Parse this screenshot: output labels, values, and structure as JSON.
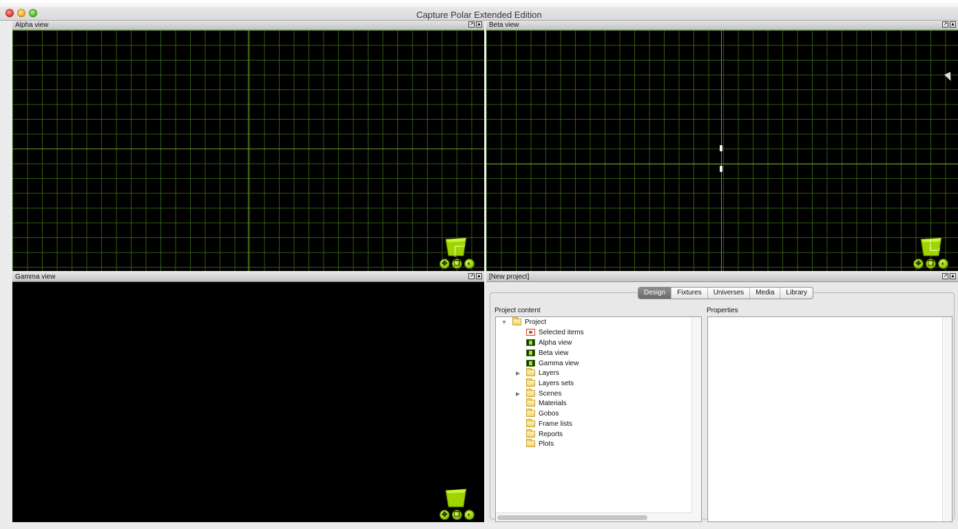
{
  "window": {
    "title": "Capture Polar Extended Edition"
  },
  "views": {
    "alpha": {
      "title": "Alpha view"
    },
    "beta": {
      "title": "Beta view"
    },
    "gamma": {
      "title": "Gamma view"
    }
  },
  "project_panel": {
    "title": "[New project]",
    "tabs": [
      {
        "label": "Design",
        "active": true
      },
      {
        "label": "Fixtures",
        "active": false
      },
      {
        "label": "Universes",
        "active": false
      },
      {
        "label": "Media",
        "active": false
      },
      {
        "label": "Library",
        "active": false
      }
    ],
    "content_label": "Project content",
    "properties_label": "Properties",
    "tree": [
      {
        "label": "Project",
        "icon": "folder-icon",
        "expanded": true
      },
      {
        "label": "Selected items",
        "icon": "selection-icon"
      },
      {
        "label": "Alpha view",
        "icon": "view-icon"
      },
      {
        "label": "Beta view",
        "icon": "view-icon"
      },
      {
        "label": "Gamma view",
        "icon": "view-icon"
      },
      {
        "label": "Layers",
        "icon": "folder-icon",
        "expandable": true
      },
      {
        "label": "Layers sets",
        "icon": "folder-icon"
      },
      {
        "label": "Scenes",
        "icon": "folder-icon",
        "expandable": true
      },
      {
        "label": "Materials",
        "icon": "folder-icon"
      },
      {
        "label": "Gobos",
        "icon": "folder-icon"
      },
      {
        "label": "Frame lists",
        "icon": "folder-icon"
      },
      {
        "label": "Reports",
        "icon": "folder-icon"
      },
      {
        "label": "Plots",
        "icon": "folder-icon"
      }
    ]
  },
  "colors": {
    "grid": "#467814",
    "axis": "#6fa21c",
    "accent": "#8ec300"
  },
  "icons": {
    "header_buttons": [
      "detach-icon",
      "eject-icon"
    ],
    "view_controls": [
      "move-icon",
      "copy-icon",
      "zoom-icon"
    ]
  }
}
